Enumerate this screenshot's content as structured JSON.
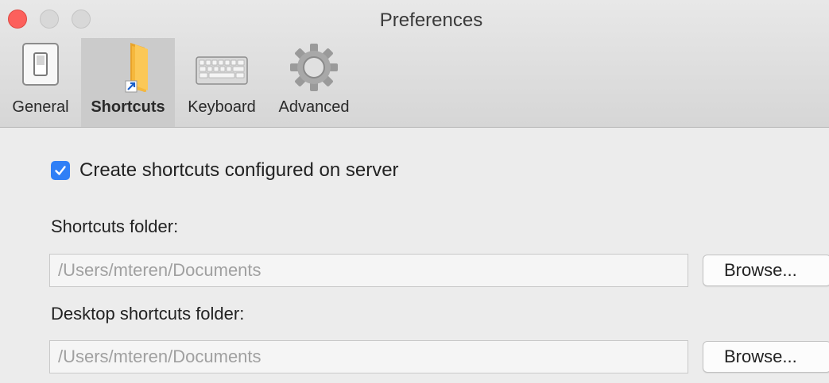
{
  "window": {
    "title": "Preferences"
  },
  "toolbar": {
    "tabs": [
      {
        "label": "General",
        "icon": "switch-icon",
        "selected": false
      },
      {
        "label": "Shortcuts",
        "icon": "folder-shortcut-icon",
        "selected": true
      },
      {
        "label": "Keyboard",
        "icon": "keyboard-icon",
        "selected": false
      },
      {
        "label": "Advanced",
        "icon": "gear-icon",
        "selected": false
      }
    ]
  },
  "shortcuts": {
    "create_checkbox": {
      "label": "Create shortcuts configured on server",
      "checked": true
    },
    "shortcuts_folder": {
      "label": "Shortcuts folder:",
      "placeholder": "/Users/mteren/Documents",
      "browse_label": "Browse..."
    },
    "desktop_folder": {
      "label": "Desktop shortcuts folder:",
      "placeholder": "/Users/mteren/Documents",
      "browse_label": "Browse..."
    }
  },
  "colors": {
    "accent": "#2f7ff6",
    "close": "#fc605c",
    "folder": "#f5b83d"
  }
}
